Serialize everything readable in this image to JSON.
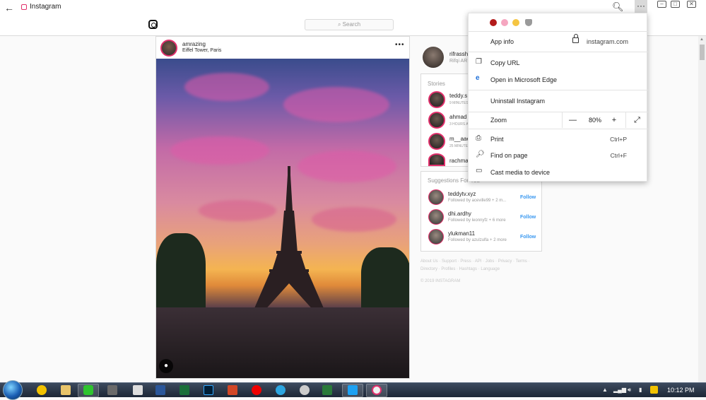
{
  "window": {
    "title": "Instagram"
  },
  "nav": {
    "search_placeholder": "Search"
  },
  "post": {
    "username": "amrazing",
    "location": "Eiffel Tower, Paris"
  },
  "sidebar": {
    "me": {
      "username": "rifrassh",
      "fullname": "Rifqi AR"
    },
    "stories": {
      "title": "Stories",
      "items": [
        {
          "name": "teddy.s",
          "time": "9 MINUTES AGO"
        },
        {
          "name": "ahmad",
          "time": "3 HOURS AGO"
        },
        {
          "name": "m__aae",
          "time": "25 MINUTES AGO"
        },
        {
          "name": "rachma",
          "time": ""
        }
      ]
    },
    "suggestions": {
      "title": "Suggestions For You",
      "items": [
        {
          "name": "teddytv.xyz",
          "sub": "Followed by aceville99 + 2 m...",
          "action": "Follow"
        },
        {
          "name": "dhi.ardhy",
          "sub": "Followed by leonnyfz + 6 more",
          "action": "Follow"
        },
        {
          "name": "ylukman11",
          "sub": "Followed by azulzulfa + 2 more",
          "action": "Follow"
        }
      ]
    },
    "footer_links": "About Us · Support · Press · API · Jobs · Privacy · Terms · Directory · Profiles · Hashtags · Language",
    "copyright": "© 2019 INSTAGRAM"
  },
  "menu": {
    "app_info": "App info",
    "domain": "instagram.com",
    "copy_url": "Copy URL",
    "open_edge": "Open in Microsoft Edge",
    "uninstall": "Uninstall Instagram",
    "zoom_label": "Zoom",
    "zoom_minus": "—",
    "zoom_value": "80%",
    "zoom_plus": "+",
    "print": "Print",
    "print_shortcut": "Ctrl+P",
    "find": "Find on page",
    "find_shortcut": "Ctrl+F",
    "cast": "Cast media to device"
  },
  "taskbar": {
    "time": "10:12 PM"
  },
  "colors": {
    "accent": "#3897f0",
    "story_ring": "#e1306c"
  }
}
